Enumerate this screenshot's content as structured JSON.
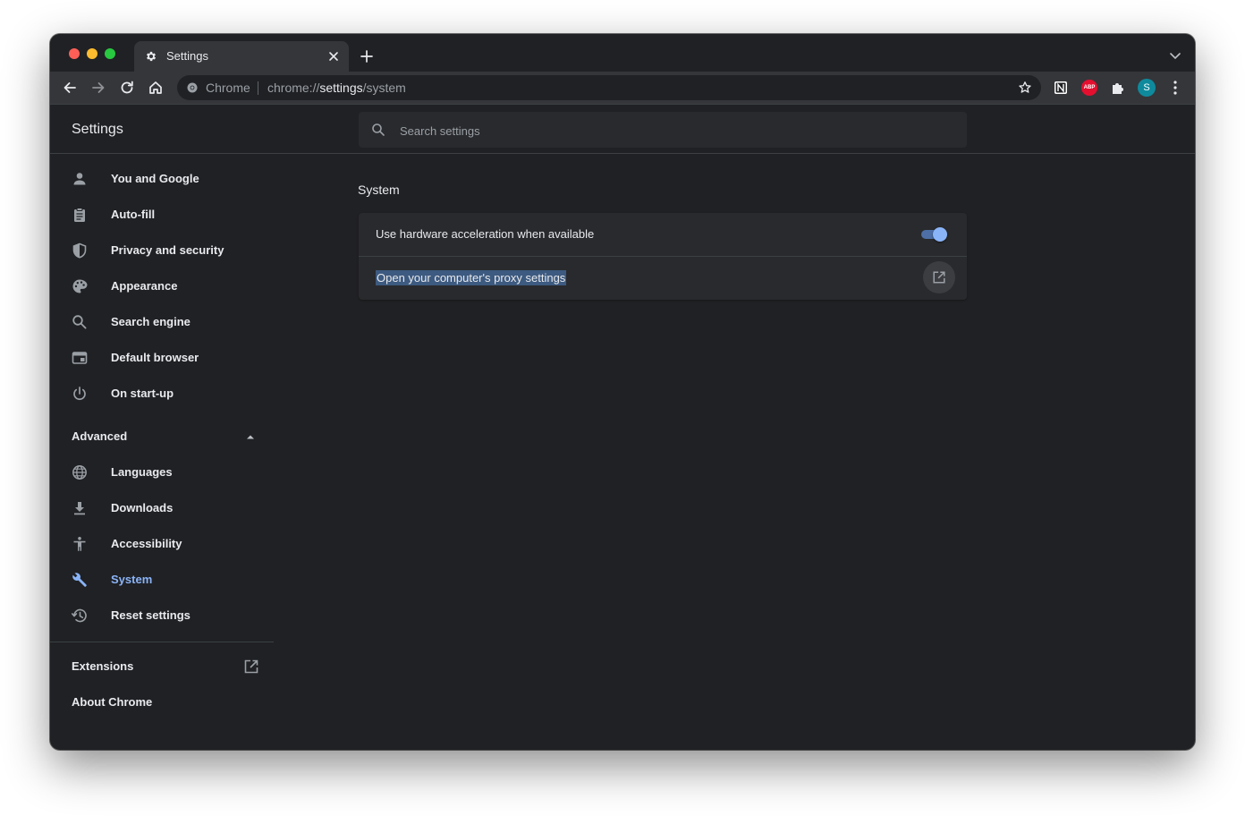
{
  "window": {
    "tab": {
      "title": "Settings"
    },
    "omnibox": {
      "chip": "Chrome",
      "url_prefix": "chrome://",
      "url_host": "settings",
      "url_path": "/system"
    },
    "profile_initial": "S",
    "extensions": [
      "notion",
      "adblock-plus",
      "extensions-puzzle"
    ],
    "abp_label": "ABP"
  },
  "header": {
    "title": "Settings",
    "search_placeholder": "Search settings"
  },
  "sidebar": {
    "items": [
      {
        "label": "You and Google",
        "icon": "person-icon"
      },
      {
        "label": "Auto-fill",
        "icon": "clipboard-icon"
      },
      {
        "label": "Privacy and security",
        "icon": "shield-icon"
      },
      {
        "label": "Appearance",
        "icon": "palette-icon"
      },
      {
        "label": "Search engine",
        "icon": "search-icon"
      },
      {
        "label": "Default browser",
        "icon": "browser-icon"
      },
      {
        "label": "On start-up",
        "icon": "power-icon"
      }
    ],
    "advanced_label": "Advanced",
    "advanced_items": [
      {
        "label": "Languages",
        "icon": "globe-icon"
      },
      {
        "label": "Downloads",
        "icon": "download-icon"
      },
      {
        "label": "Accessibility",
        "icon": "accessibility-icon"
      },
      {
        "label": "System",
        "icon": "wrench-icon",
        "active": true
      },
      {
        "label": "Reset settings",
        "icon": "history-icon"
      }
    ],
    "extensions_label": "Extensions",
    "about_label": "About Chrome"
  },
  "main": {
    "section_title": "System",
    "rows": [
      {
        "label": "Use hardware acceleration when available",
        "toggle_on": true
      },
      {
        "label": "Open your computer's proxy settings",
        "selected": true
      }
    ]
  },
  "colors": {
    "accent": "#8ab4f8",
    "background": "#202124",
    "card": "#292a2d",
    "toolbar": "#35363a"
  }
}
